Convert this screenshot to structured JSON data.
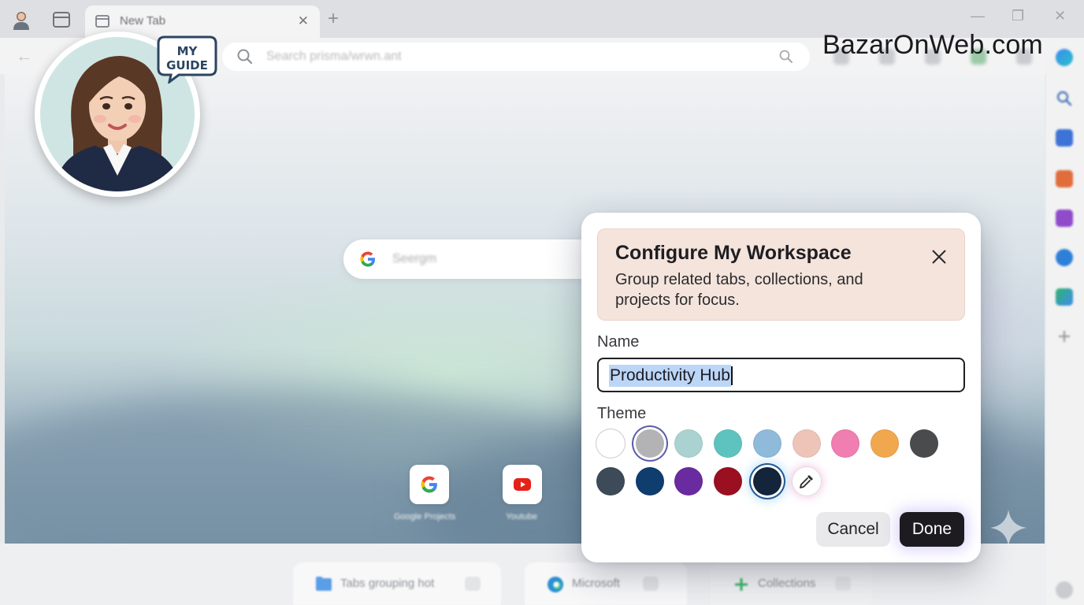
{
  "brand": {
    "text": "BazarOnWeb.com"
  },
  "browser": {
    "tab": {
      "title": "New Tab",
      "close_glyph": "✕"
    },
    "new_tab_glyph": "+",
    "window_controls": {
      "minimize": "—",
      "maximize": "❐",
      "close": "✕"
    },
    "address_bar": {
      "text": "Search prisma/wrwn.ant"
    },
    "back_glyph": "←"
  },
  "guide": {
    "bubble_line1": "MY",
    "bubble_line2": "GUIDE"
  },
  "ntp": {
    "search_text": "Seergm",
    "tiles": [
      {
        "label": "Google Projects",
        "icon": "google-icon"
      },
      {
        "label": "Youtube",
        "icon": "youtube-icon"
      }
    ]
  },
  "bottom_bar": {
    "items": [
      {
        "label": "Tabs grouping hot",
        "icon": "folder-icon"
      },
      {
        "label": "Microsoft",
        "icon": "edge-icon"
      },
      {
        "label": "Collections",
        "icon": "plus-icon"
      }
    ]
  },
  "dialog": {
    "title": "Configure My Workspace",
    "description": "Group related tabs, collections, and projects for focus.",
    "name_label": "Name",
    "name_value": "Productivity Hub",
    "theme_label": "Theme",
    "cancel_label": "Cancel",
    "done_label": "Done",
    "swatches_row1": [
      "#ffffff",
      "#b3b3b5",
      "#a9d2d1",
      "#5ec3bf",
      "#90bada",
      "#eec4b9",
      "#f07eb0",
      "#f0a74e",
      "#4a4b4d"
    ],
    "swatches_row2": [
      "#3d4a57",
      "#0f3d6e",
      "#6a2aa0",
      "#9a1020",
      "#14243a"
    ],
    "selected_swatch": "#14243a",
    "outlined_swatch": "#b3b3b5"
  }
}
